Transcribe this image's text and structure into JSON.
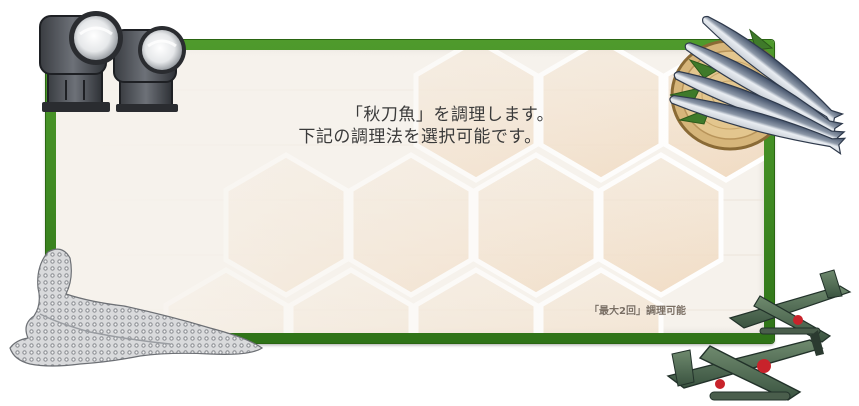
{
  "dialog": {
    "message_line_1": "「秋刀魚」を調理します。",
    "message_line_2": "下記の調理法を選択可能です。",
    "limit_note": "「最大2回」調理可能"
  },
  "icons": {
    "searchlights": "searchlight-icon",
    "saury": "saury-basket-icon",
    "net": "fishing-net-icon",
    "planes": "seaplane-icon"
  },
  "colors": {
    "frame_green": "#3f8a22",
    "panel_bg": "#f6f2ec",
    "hex_tint": "#f0dcc4",
    "text": "#3a3a3a"
  }
}
